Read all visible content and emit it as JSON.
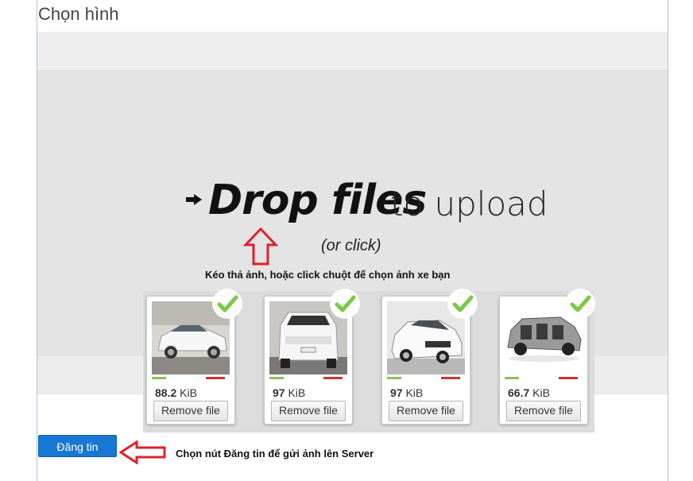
{
  "page": {
    "title": "Chọn hình"
  },
  "dropzone": {
    "main_text": "Drop files",
    "sub_text": "to upload",
    "or_click": "(or click)",
    "annotation": "Kéo thả ảnh, hoặc click chuột để chọn ảnh xe bạn"
  },
  "previews": [
    {
      "size_value": "88.2",
      "size_unit": "KiB",
      "remove_label": "Remove file",
      "status": "success-check-icon"
    },
    {
      "size_value": "97",
      "size_unit": "KiB",
      "remove_label": "Remove file",
      "status": "success-check-icon"
    },
    {
      "size_value": "97",
      "size_unit": "KiB",
      "remove_label": "Remove file",
      "status": "success-check-icon"
    },
    {
      "size_value": "66.7",
      "size_unit": "KiB",
      "remove_label": "Remove file",
      "status": "success-check-icon"
    }
  ],
  "footer": {
    "post_button_label": "Đăng tin",
    "annotation": "Chọn nút Đăng tin để gửi ảnh lên Server"
  },
  "colors": {
    "post_button": "#1877d3",
    "check": "#7cc84a",
    "annotation_arrow": "#e0202a"
  }
}
